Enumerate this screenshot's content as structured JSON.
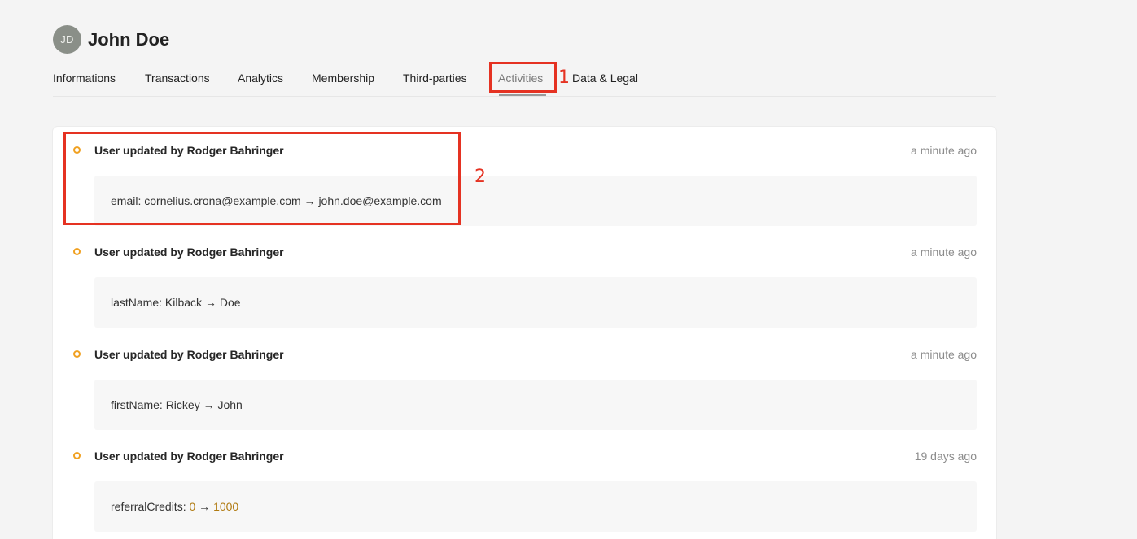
{
  "user": {
    "initials": "JD",
    "name": "John Doe"
  },
  "tabs": [
    {
      "label": "Informations"
    },
    {
      "label": "Transactions"
    },
    {
      "label": "Analytics"
    },
    {
      "label": "Membership"
    },
    {
      "label": "Third-parties"
    },
    {
      "label": "Activities",
      "active": true
    },
    {
      "label": "Data & Legal"
    }
  ],
  "annotations": [
    {
      "number": "1"
    },
    {
      "number": "2"
    }
  ],
  "activities": [
    {
      "title": "User updated by Rodger Bahringer",
      "time": "a minute ago",
      "field": "email",
      "from": "cornelius.crona@example.com",
      "arrow": "→",
      "to": "john.doe@example.com"
    },
    {
      "title": "User updated by Rodger Bahringer",
      "time": "a minute ago",
      "field": "lastName",
      "from": "Kilback",
      "arrow": "→",
      "to": "Doe"
    },
    {
      "title": "User updated by Rodger Bahringer",
      "time": "a minute ago",
      "field": "firstName",
      "from": "Rickey",
      "arrow": "→",
      "to": "John"
    },
    {
      "title": "User updated by Rodger Bahringer",
      "time": "19 days ago",
      "field": "referralCredits",
      "from": "0",
      "arrow": "→",
      "to": "1000"
    }
  ],
  "colors": {
    "accent_dot": "#f0a020",
    "annotation": "#e53222",
    "number_value": "#b07a10"
  }
}
